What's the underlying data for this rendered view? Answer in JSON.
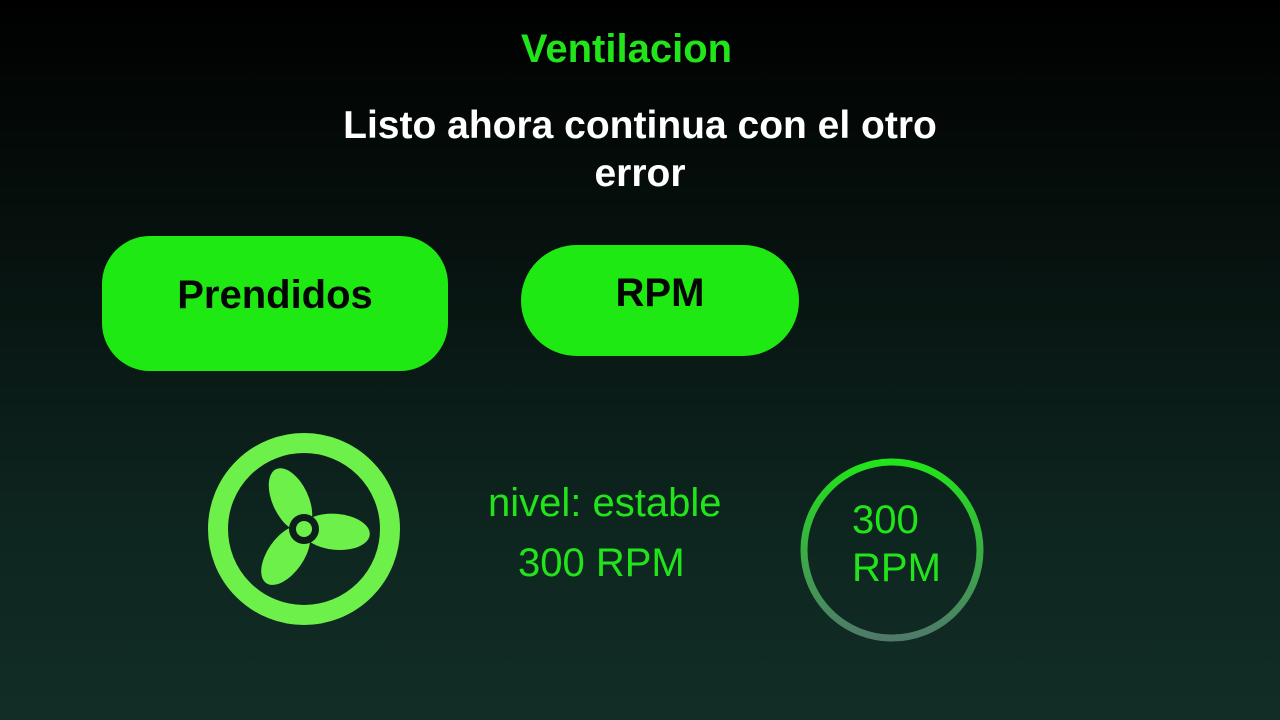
{
  "header": {
    "title": "Ventilacion",
    "message": "Listo ahora continua con el otro error"
  },
  "buttons": {
    "prendidos_label": "Prendidos",
    "rpm_label": "RPM"
  },
  "status": {
    "level_text": "nivel: estable",
    "rpm_text": "300 RPM"
  },
  "gauge": {
    "value": "300",
    "unit": "RPM"
  },
  "icons": {
    "fan": "fan-icon"
  },
  "colors": {
    "accent": "#22e41a",
    "button_bg": "#1fe912",
    "fan_green": "#6ef04a",
    "gauge_ring_top": "#22e41a",
    "gauge_ring_bottom": "#4f7a6a",
    "text_light": "#ffffff"
  }
}
